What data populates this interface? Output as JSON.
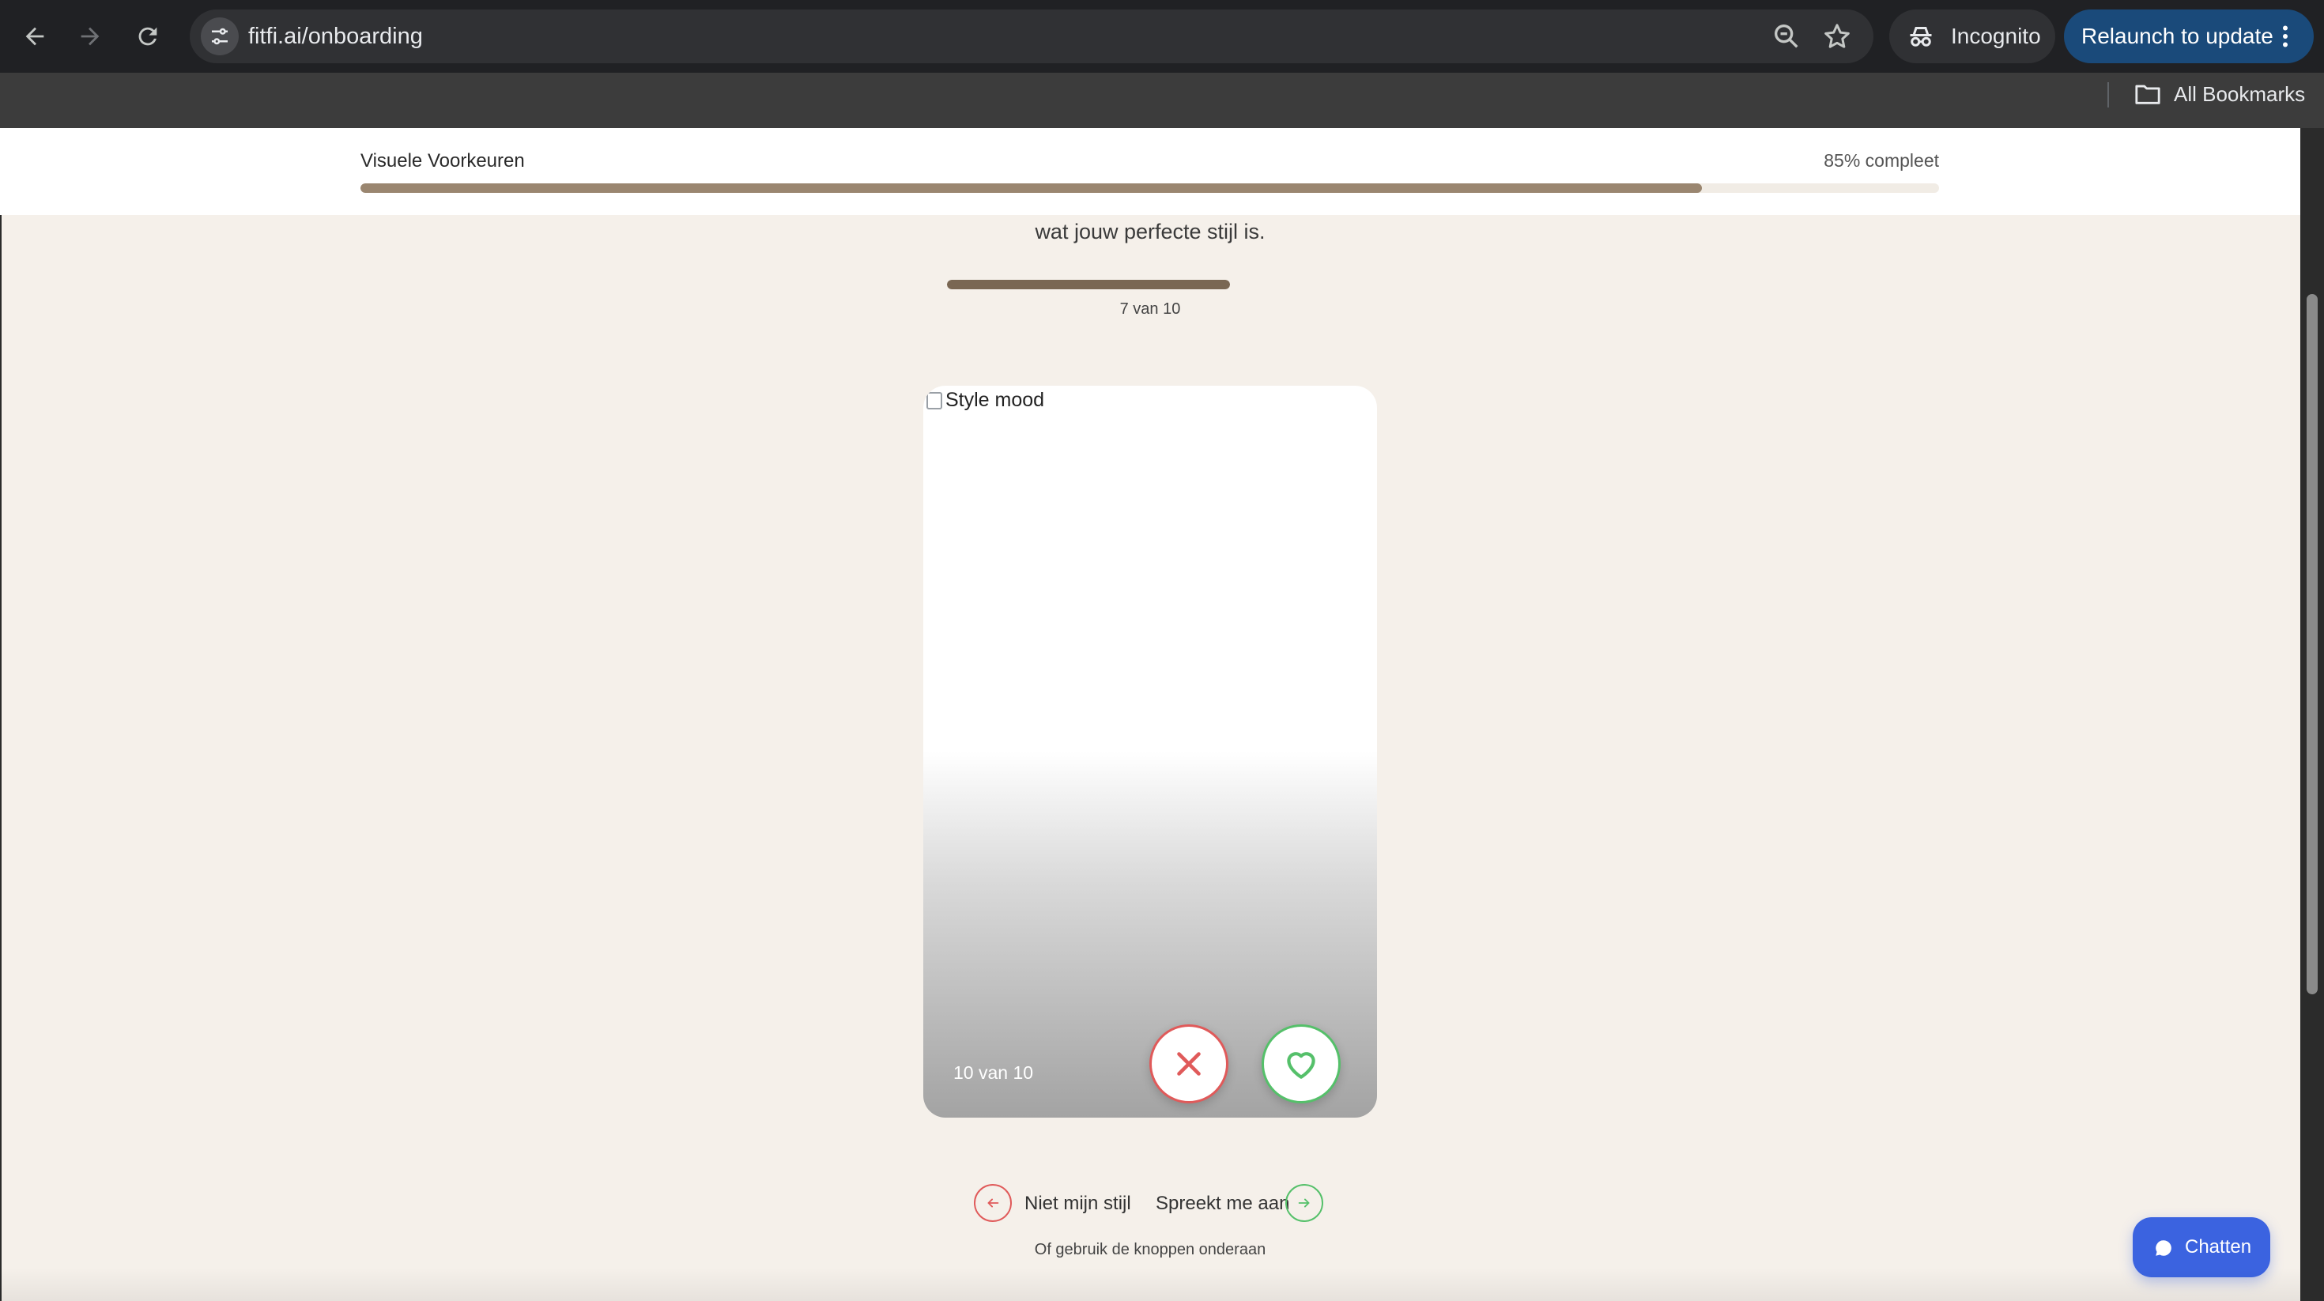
{
  "browser": {
    "url": "fitfi.ai/onboarding",
    "incognito_label": "Incognito",
    "relaunch_label": "Relaunch to update",
    "bookmarks_label": "All Bookmarks",
    "icons": [
      "back-arrow-icon",
      "forward-arrow-icon",
      "reload-icon",
      "site-settings-icon",
      "zoom-icon",
      "star-icon",
      "incognito-icon",
      "more-vert-icon",
      "folder-icon"
    ]
  },
  "progress": {
    "section_title": "Visuele Voorkeuren",
    "percent_label": "85% compleet",
    "percent": 0.85
  },
  "intro": {
    "text": "wat jouw perfecte stijl is."
  },
  "step": {
    "label": "7 van 10",
    "fill": 1.0
  },
  "card": {
    "image_alt": "Style mood",
    "count_label": "10 van 10"
  },
  "hints": {
    "dislike_label": "Niet mijn stijl",
    "like_label": "Spreekt me aan",
    "subtext": "Of gebruik de knoppen onderaan"
  },
  "chat": {
    "label": "Chatten"
  },
  "colors": {
    "page_bg": "#f5f0ea",
    "progress_fill": "#9a8670",
    "dislike": "#e05a5a",
    "like": "#55c06a",
    "chat": "#3b63e0",
    "relaunch": "#1a4a7a"
  }
}
